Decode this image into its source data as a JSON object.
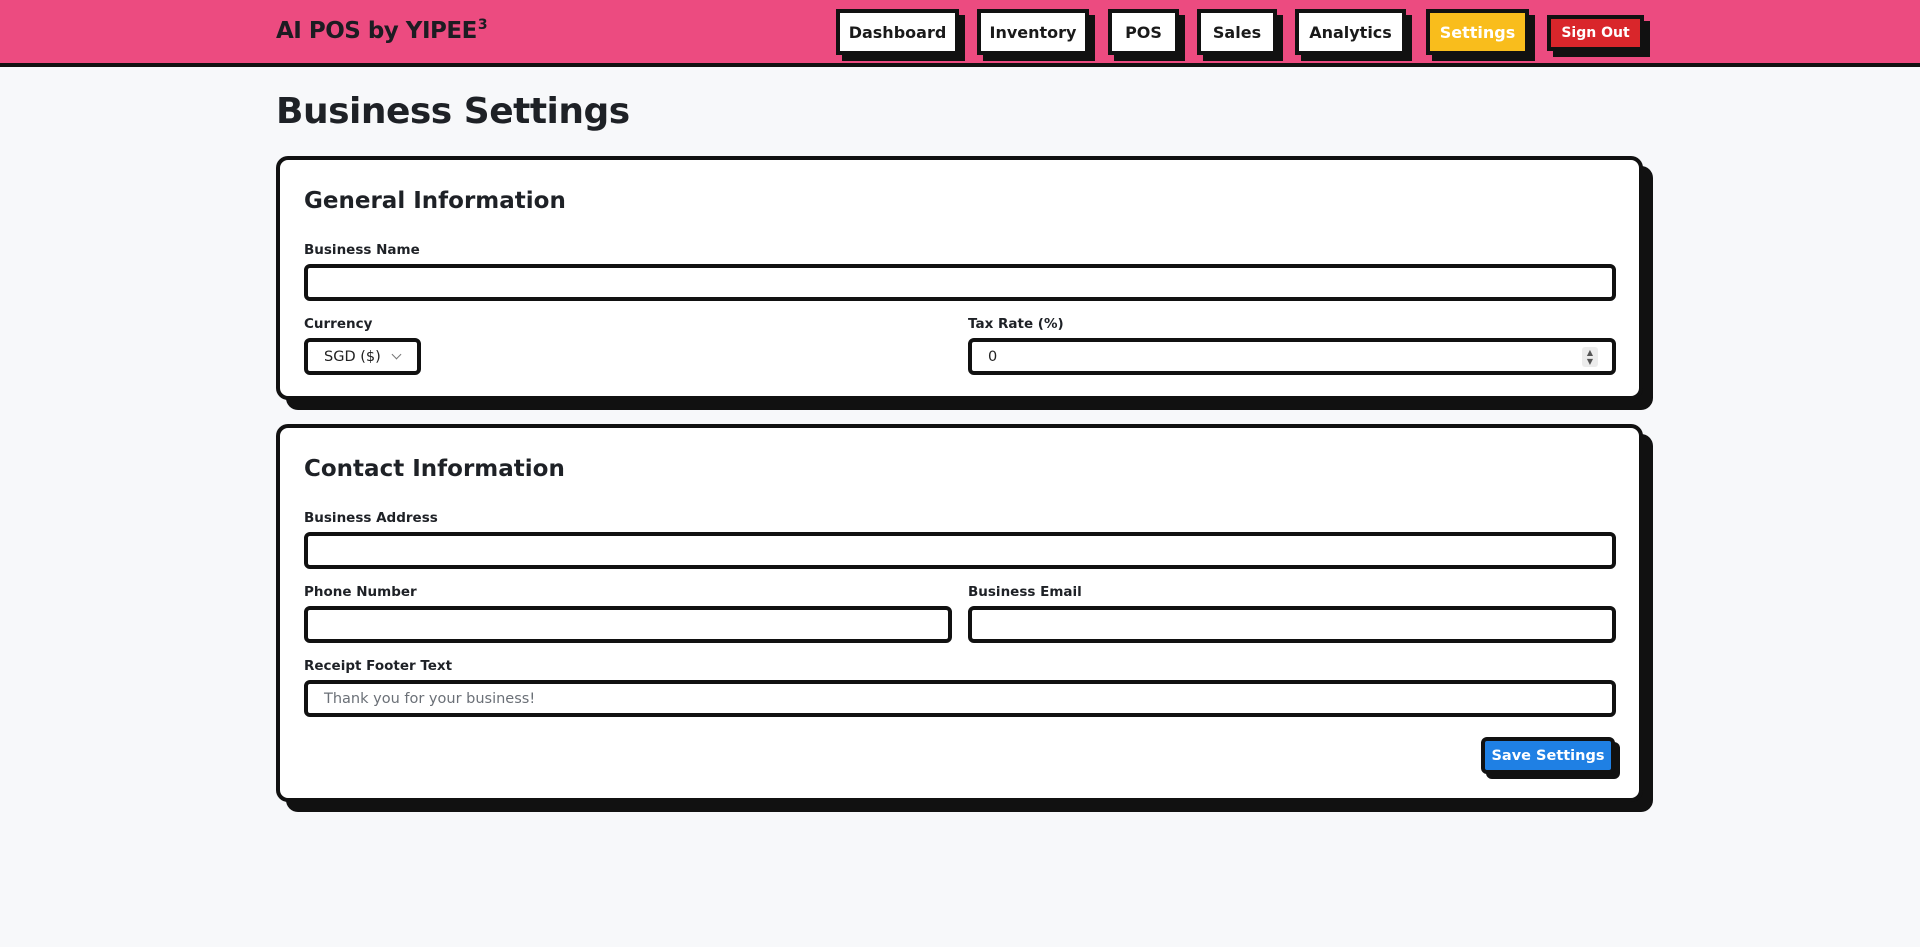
{
  "app": {
    "brand": "AI POS by YIPEE",
    "brand_sup": "3"
  },
  "nav": {
    "items": [
      {
        "label": "Dashboard",
        "active": false
      },
      {
        "label": "Inventory",
        "active": false
      },
      {
        "label": "POS",
        "active": false
      },
      {
        "label": "Sales",
        "active": false
      },
      {
        "label": "Analytics",
        "active": false
      },
      {
        "label": "Settings",
        "active": true
      }
    ],
    "sign_out": "Sign Out"
  },
  "page": {
    "title": "Business Settings"
  },
  "general": {
    "title": "General Information",
    "business_name_label": "Business Name",
    "business_name_value": "",
    "currency_label": "Currency",
    "currency_value": "SGD ($)",
    "tax_rate_label": "Tax Rate (%)",
    "tax_rate_value": "0"
  },
  "contact": {
    "title": "Contact Information",
    "address_label": "Business Address",
    "address_value": "",
    "phone_label": "Phone Number",
    "phone_value": "",
    "email_label": "Business Email",
    "email_value": "",
    "footer_label": "Receipt Footer Text",
    "footer_placeholder": "Thank you for your business!"
  },
  "actions": {
    "save_label": "Save Settings"
  },
  "colors": {
    "header_bg": "#ec4b80",
    "active_nav": "#f9bd1c",
    "sign_out": "#d9262b",
    "save_button": "#1f80e4",
    "page_bg": "#f7f8fa"
  }
}
